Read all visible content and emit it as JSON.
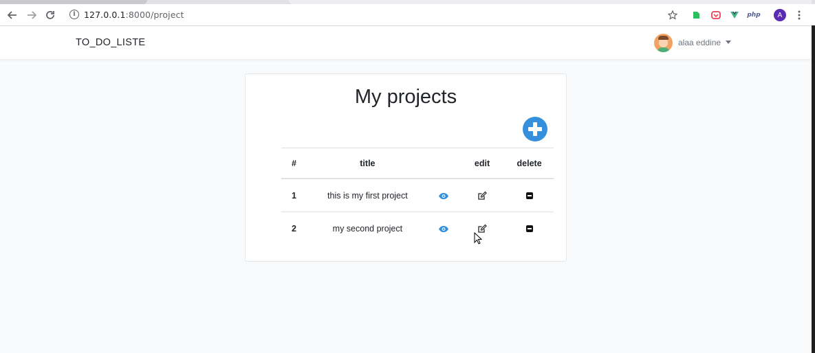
{
  "browser": {
    "url_host": "127.0.0.1",
    "url_path": ":8000/project",
    "profile_initial": "A",
    "php_ext_label": "php"
  },
  "navbar": {
    "brand": "TO_DO_LISTE",
    "user_name": "alaa eddine"
  },
  "main": {
    "title": "My projects",
    "table": {
      "headers": [
        "#",
        "title",
        "",
        "edit",
        "delete"
      ],
      "rows": [
        {
          "num": "1",
          "title": "this is my first project"
        },
        {
          "num": "2",
          "title": "my second project"
        }
      ]
    }
  },
  "colors": {
    "accent": "#3490dc",
    "background": "#f8fafc"
  }
}
